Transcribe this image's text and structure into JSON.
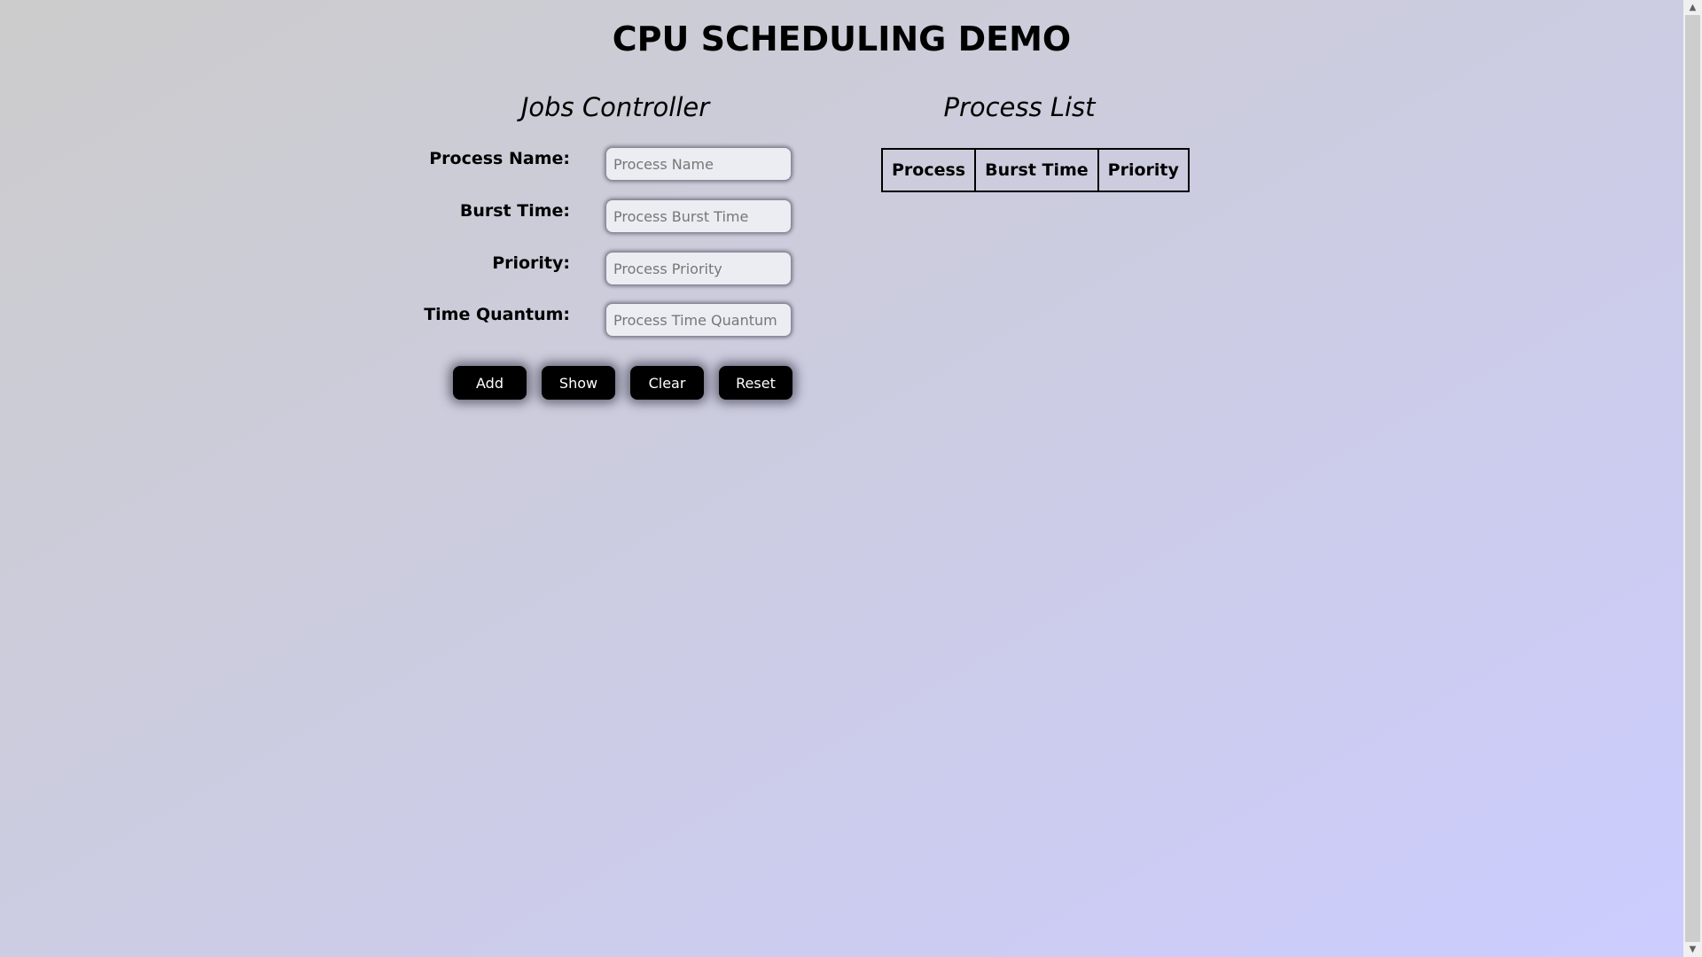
{
  "page": {
    "title": "CPU SCHEDULING DEMO"
  },
  "jobs_controller": {
    "heading": "Jobs Controller",
    "fields": [
      {
        "label": "Process Name:",
        "placeholder": "Process Name",
        "value": ""
      },
      {
        "label": "Burst Time:",
        "placeholder": "Process Burst Time",
        "value": ""
      },
      {
        "label": "Priority:",
        "placeholder": "Process Priority",
        "value": ""
      },
      {
        "label": "Time Quantum:",
        "placeholder": "Process Time Quantum",
        "value": ""
      }
    ],
    "buttons": {
      "add": "Add",
      "show": "Show",
      "clear": "Clear",
      "reset": "Reset"
    }
  },
  "process_list": {
    "heading": "Process List",
    "columns": [
      "Process",
      "Burst Time",
      "Priority"
    ],
    "rows": []
  },
  "scrollbar": {
    "up_icon": "chevron-up-icon",
    "down_icon": "chevron-down-icon"
  },
  "colors": {
    "background_start": "#cccccc",
    "background_end": "#ccccff",
    "button_bg": "#000000",
    "button_text": "#ffffff"
  }
}
